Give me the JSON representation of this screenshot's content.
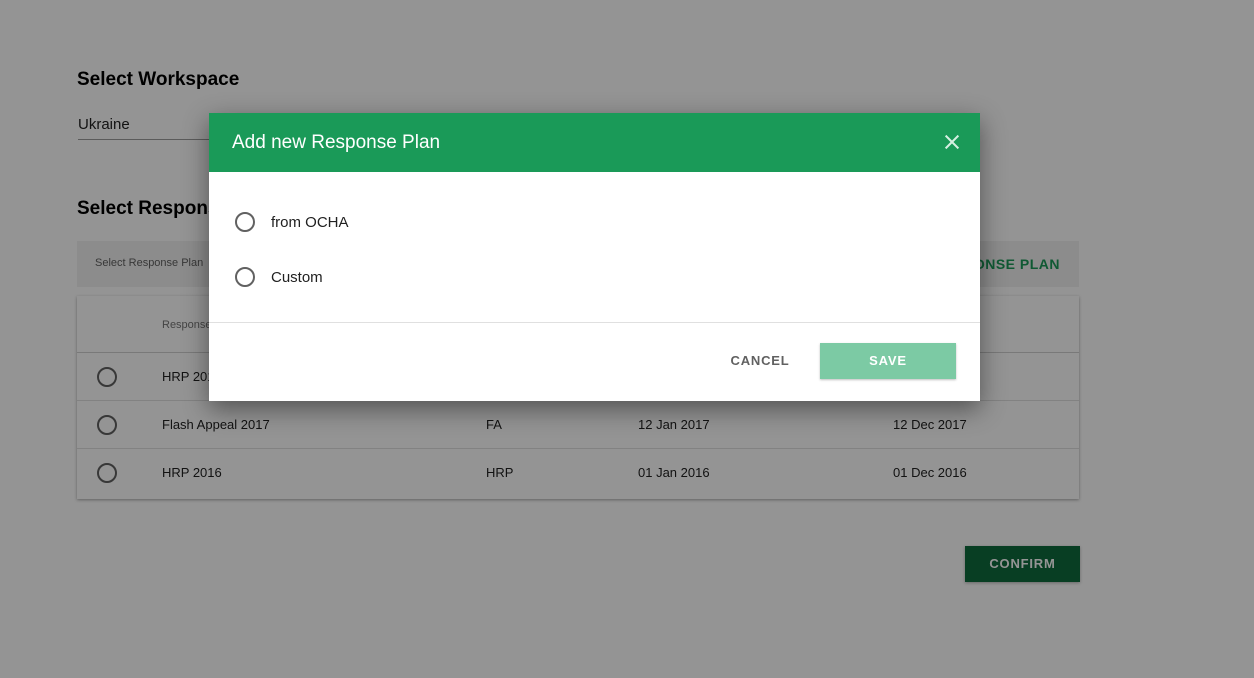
{
  "workspace": {
    "title": "Select Workspace",
    "selected": "Ukraine"
  },
  "response_plan": {
    "title": "Select Response Plan",
    "filter_label": "Select Response Plan",
    "add_link": "ADD NEW RESPONSE PLAN",
    "header_first": "Response Plan",
    "rows": [
      {
        "name": "HRP 2017",
        "type": "",
        "start": "",
        "end": ""
      },
      {
        "name": "Flash Appeal 2017",
        "type": "FA",
        "start": "12 Jan 2017",
        "end": "12 Dec 2017"
      },
      {
        "name": "HRP 2016",
        "type": "HRP",
        "start": "01 Jan 2016",
        "end": "01 Dec 2016"
      }
    ]
  },
  "confirm_label": "CONFIRM",
  "dialog": {
    "title": "Add new Response Plan",
    "options": [
      "from OCHA",
      "Custom"
    ],
    "cancel_label": "CANCEL",
    "save_label": "SAVE"
  },
  "colors": {
    "accent": "#1a9a58",
    "confirm": "#0e6b3d",
    "save_disabled": "#7ccaa4"
  }
}
